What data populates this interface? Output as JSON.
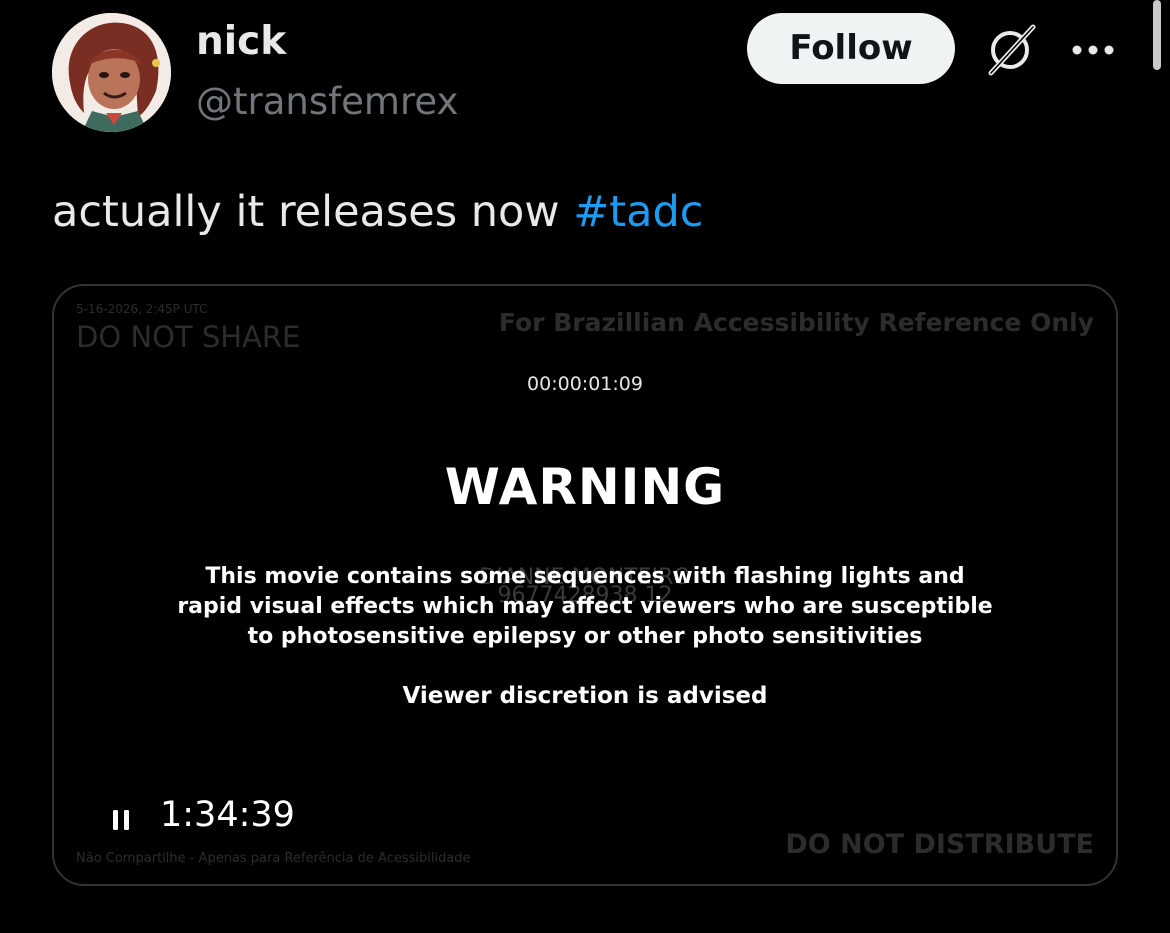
{
  "author": {
    "display_name": "nick",
    "handle": "@transfemrex"
  },
  "actions": {
    "follow_label": "Follow",
    "grok_icon": "grok-icon",
    "more_icon": "more-icon"
  },
  "tweet": {
    "text": "actually it releases now ",
    "hashtag": "#tadc"
  },
  "video": {
    "timecode": "00:00:01:09",
    "warning_title": "WARNING",
    "warning_lines": [
      "This movie contains some sequences with flashing lights and",
      "rapid visual effects which may affect viewers who are susceptible",
      "to photosensitive epilepsy or other photo sensitivities"
    ],
    "advisory": "Viewer discretion is advised",
    "duration": "1:34:39",
    "play_state_icon": "pause-icon",
    "watermarks": {
      "date": "5-16-2026, 2:45P UTC",
      "do_not_share": "DO NOT SHARE",
      "brazil_reference": "For Brazillian Accessibility Reference Only",
      "do_not_distribute": "DO NOT DISTRIBUTE",
      "nao_compartilhe": "Não Compartilhe - Apenas para Referência de Acessibilidade",
      "name": "DIANNE MONTEIRO",
      "number": "9677428938 12"
    }
  },
  "colors": {
    "background": "#000000",
    "text_primary": "#e7e9ea",
    "text_secondary": "#71767b",
    "link": "#1d9bf0",
    "follow_bg": "#eff3f4",
    "card_border": "#2f3336"
  }
}
